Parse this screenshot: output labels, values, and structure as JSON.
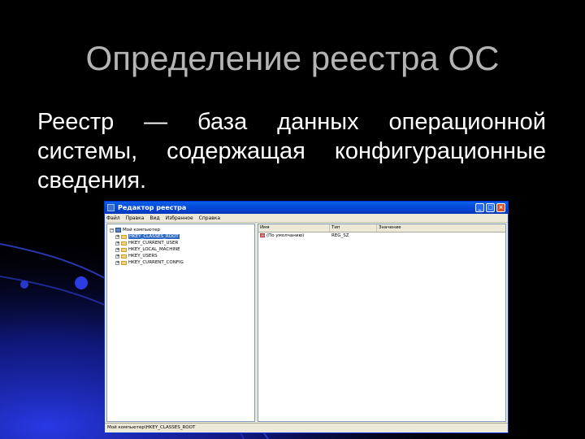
{
  "slide": {
    "title": "Определение реестра ОС",
    "text": "Реестр — база данных операционной системы, содержащая конфигурационные сведения."
  },
  "window": {
    "title": "Редактор реестра",
    "menu": [
      "Файл",
      "Правка",
      "Вид",
      "Избранное",
      "Справка"
    ],
    "tree": {
      "root": "Мой компьютер",
      "hives": [
        "HKEY_CLASSES_ROOT",
        "HKEY_CURRENT_USER",
        "HKEY_LOCAL_MACHINE",
        "HKEY_USERS",
        "HKEY_CURRENT_CONFIG"
      ],
      "selected_index": 0
    },
    "list": {
      "columns": [
        "Имя",
        "Тип",
        "Значение"
      ],
      "rows": [
        {
          "name": "(По умолчанию)",
          "type": "REG_SZ",
          "value": ""
        }
      ]
    },
    "status": "Мой компьютер\\HKEY_CLASSES_ROOT"
  },
  "colors": {
    "background": "#000000",
    "title": "#b4b4b4",
    "text": "#ffffff",
    "accent_blue": "#1a2bb0",
    "titlebar": "#0a5fe6"
  }
}
